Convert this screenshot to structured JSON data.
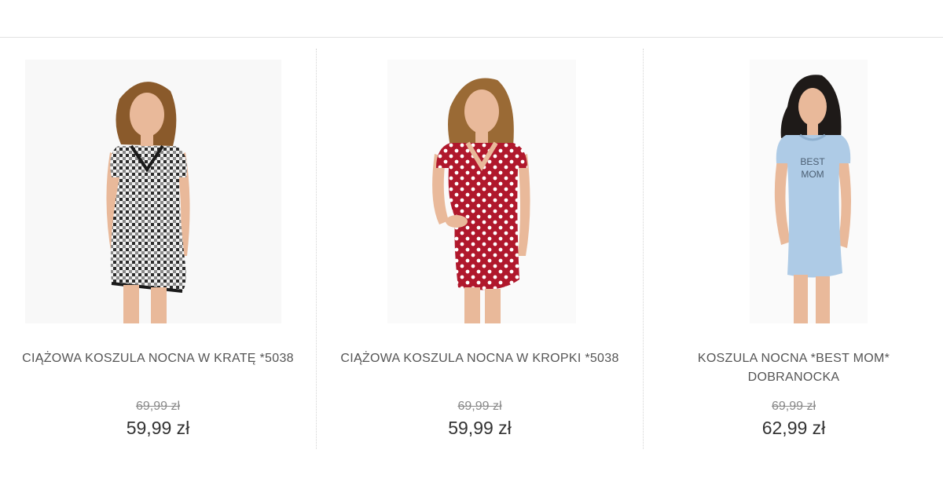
{
  "products": [
    {
      "title": "CIĄŻOWA KOSZULA NOCNA W KRATĘ *5038",
      "old_price": "69,99 zł",
      "price": "59,99 zł",
      "image": "model-in-checked-nightdress-icon"
    },
    {
      "title": "CIĄŻOWA KOSZULA NOCNA W KROPKI *5038",
      "old_price": "69,99 zł",
      "price": "59,99 zł",
      "image": "model-in-red-polka-dot-nightdress-icon"
    },
    {
      "title": "KOSZULA NOCNA *BEST MOM* DOBRANOCKA",
      "old_price": "69,99 zł",
      "price": "62,99 zł",
      "image": "model-in-blue-best-mom-nightdress-icon",
      "print_text": [
        "BEST",
        "MOM"
      ]
    }
  ],
  "colors": {
    "checked_dress": "#2b2b2b",
    "red_dress": "#b0182c",
    "blue_dress": "#aecbe6",
    "skin": "#e9b99a",
    "hair_light": "#8a5a2b",
    "hair_dark": "#1e1a18"
  }
}
